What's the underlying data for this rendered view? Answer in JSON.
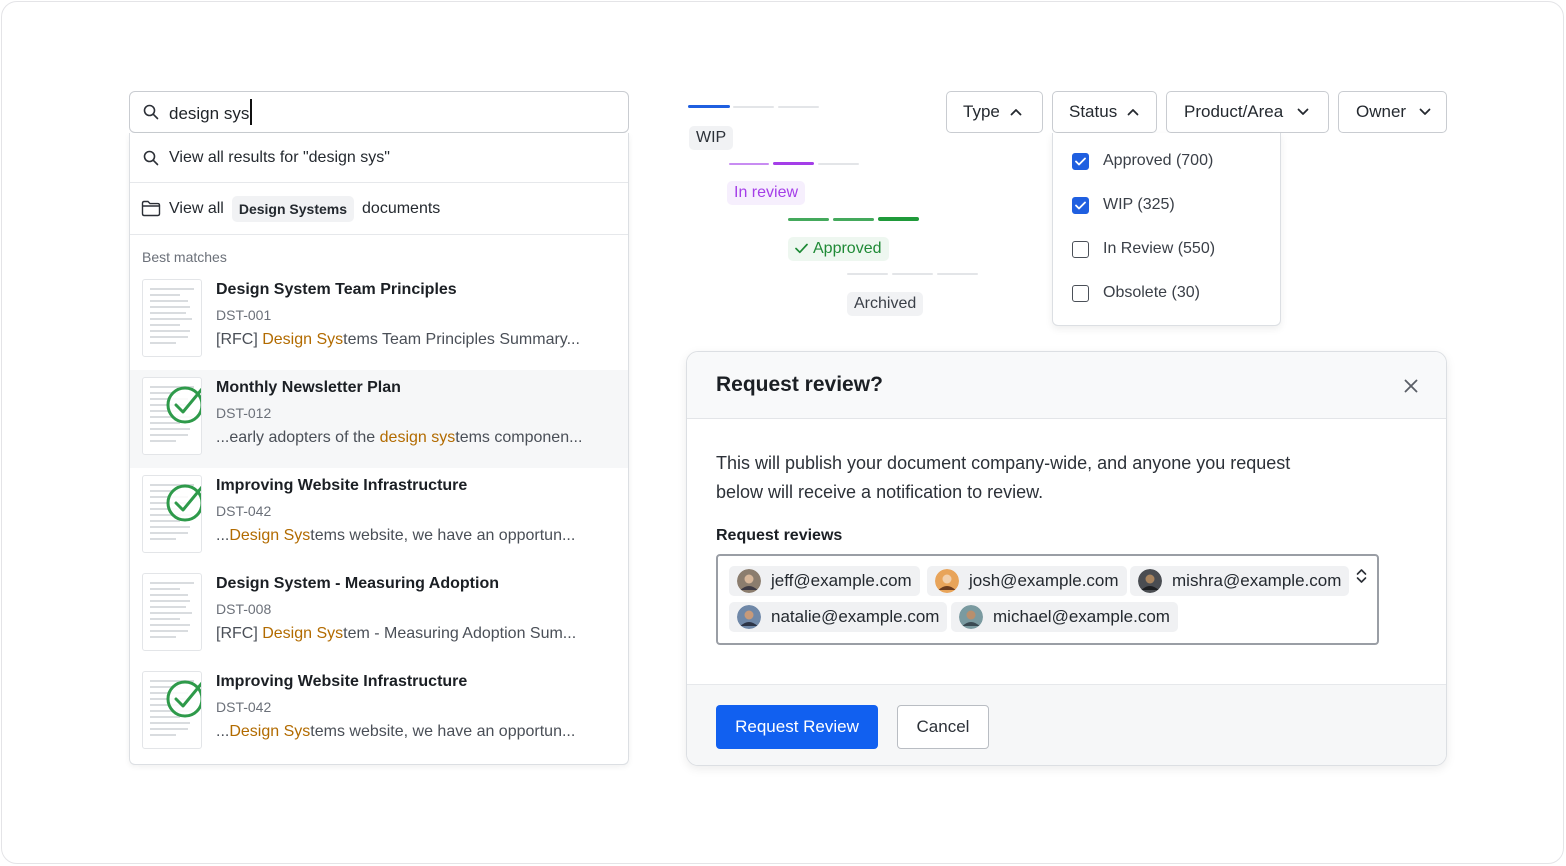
{
  "search": {
    "query": "design sys",
    "view_all_results": "View all results for \"design sys\"",
    "view_all_prefix": "View all",
    "collection_chip": "Design Systems",
    "view_all_suffix": "documents",
    "best_matches_label": "Best matches",
    "results": [
      {
        "title": "Design System Team Principles",
        "id": "DST-001",
        "pre": "[RFC] ",
        "hit": "Design Sys",
        "post": "tems Team Principles Summary...",
        "approved": false
      },
      {
        "title": "Monthly Newsletter Plan",
        "id": "DST-012",
        "pre": "...early adopters of the ",
        "hit": "design sys",
        "post": "tems componen...",
        "approved": true
      },
      {
        "title": "Improving Website Infrastructure",
        "id": "DST-042",
        "pre": "...",
        "hit": "Design Sys",
        "post": "tems website, we have an opportun...",
        "approved": true
      },
      {
        "title": "Design System - Measuring Adoption",
        "id": "DST-008",
        "pre": "[RFC] ",
        "hit": "Design Sys",
        "post": "tem - Measuring Adoption Sum...",
        "approved": false
      },
      {
        "title": "Improving Website Infrastructure",
        "id": "DST-042",
        "pre": "...",
        "hit": "Design Sys",
        "post": "tems website, we have an opportun...",
        "approved": true
      }
    ]
  },
  "statuses": {
    "wip": "WIP",
    "in_review": "In review",
    "approved": "Approved",
    "archived": "Archived",
    "colors": {
      "wip": "#1f5fe0",
      "in_review": "#a43ee8",
      "approved": "#1f9a3a",
      "track": "#e3e5e8"
    }
  },
  "filters": {
    "type": "Type",
    "status": "Status",
    "product": "Product/Area",
    "owner": "Owner"
  },
  "status_menu": [
    {
      "label": "Approved (700)",
      "checked": true
    },
    {
      "label": "WIP (325)",
      "checked": true
    },
    {
      "label": "In Review (550)",
      "checked": false
    },
    {
      "label": "Obsolete (30)",
      "checked": false
    }
  ],
  "modal": {
    "title": "Request review?",
    "description": "This will publish your document company-wide, and anyone you request below will receive a notification to review.",
    "reviewers_label": "Request reviews",
    "reviewers": [
      "jeff@example.com",
      "josh@example.com",
      "mishra@example.com",
      "natalie@example.com",
      "michael@example.com"
    ],
    "primary_button": "Request Review",
    "secondary_button": "Cancel"
  }
}
